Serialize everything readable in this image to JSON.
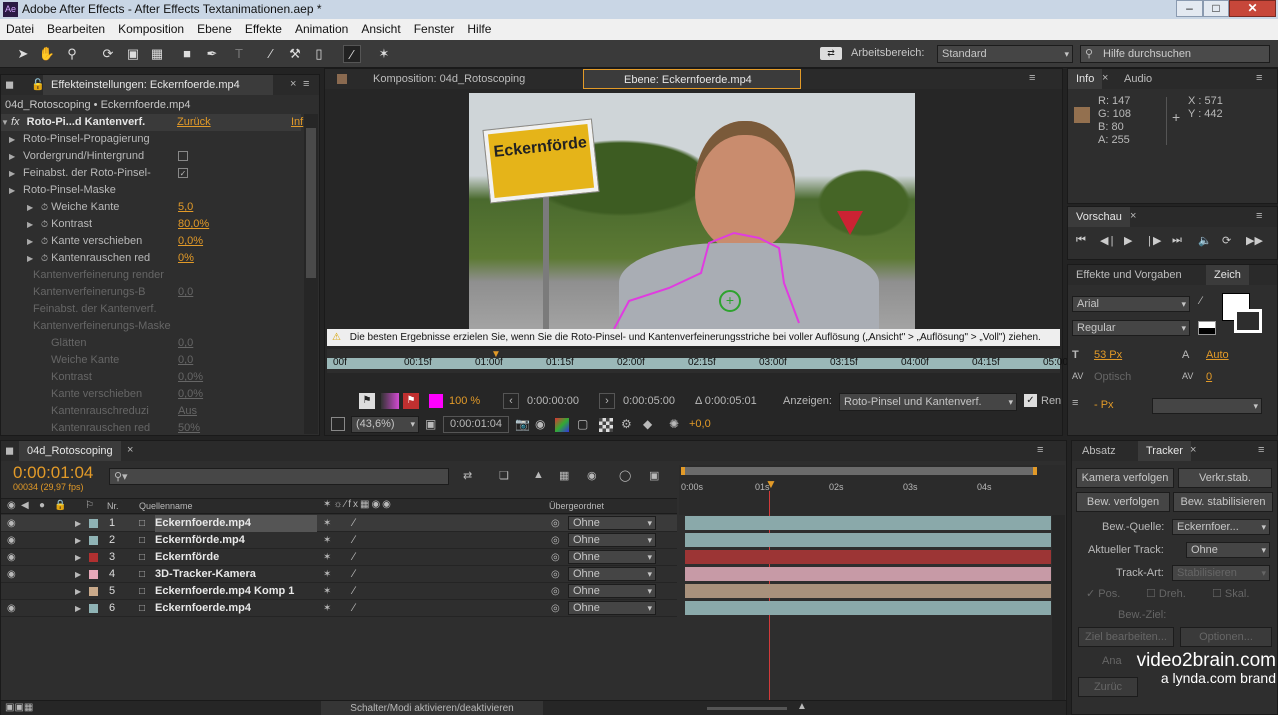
{
  "window": {
    "title": "Adobe After Effects - After Effects Textanimationen.aep *",
    "app_badge": "Ae"
  },
  "menu": [
    "Datei",
    "Bearbeiten",
    "Komposition",
    "Ebene",
    "Effekte",
    "Animation",
    "Ansicht",
    "Fenster",
    "Hilfe"
  ],
  "toolbar": {
    "workspace_label": "Arbeitsbereich:",
    "workspace_value": "Standard",
    "help_placeholder": "Hilfe durchsuchen"
  },
  "effects_panel": {
    "tab": "Effekteinstellungen: Eckernfoerde.mp4",
    "breadcrumb": "04d_Rotoscoping • Eckernfoerde.mp4",
    "effect_name": "Roto-Pi...d Kantenverf.",
    "reset": "Zurück",
    "info": "Inf",
    "rows": [
      {
        "label": "Roto-Pinsel-Propagierung",
        "value": "",
        "indent": 1
      },
      {
        "label": "Vordergrund/Hintergrund",
        "value": "",
        "indent": 1
      },
      {
        "label": "Feinabst. der Roto-Pinsel-",
        "value": "",
        "indent": 1
      },
      {
        "label": "Roto-Pinsel-Maske",
        "value": "",
        "indent": 1
      },
      {
        "label": "Weiche Kante",
        "value": "5,0",
        "indent": 2
      },
      {
        "label": "Kontrast",
        "value": "80,0%",
        "indent": 2
      },
      {
        "label": "Kante verschieben",
        "value": "0,0%",
        "indent": 2
      },
      {
        "label": "Kantenrauschen red",
        "value": "0%",
        "indent": 2
      }
    ],
    "dim_rows": [
      {
        "label": "Kantenverfeinerung render",
        "value": ""
      },
      {
        "label": "Kantenverfeinerungs-B",
        "value": "0,0"
      },
      {
        "label": "Feinabst. der Kantenverf.",
        "value": ""
      },
      {
        "label": "Kantenverfeinerungs-Maske",
        "value": ""
      },
      {
        "label": "Glätten",
        "value": "0,0"
      },
      {
        "label": "Weiche Kante",
        "value": "0,0"
      },
      {
        "label": "Kontrast",
        "value": "0,0%"
      },
      {
        "label": "Kante verschieben",
        "value": "0,0%"
      },
      {
        "label": "Kantenrauschreduzi",
        "value": "Aus"
      },
      {
        "label": "Kantenrauschen red",
        "value": "50%"
      }
    ]
  },
  "viewer": {
    "tab_comp": "Komposition: 04d_Rotoscoping",
    "tab_layer": "Ebene: Eckernfoerde.mp4",
    "sign_text": "Eckernförde",
    "warning": "Die besten Ergebnisse erzielen Sie, wenn Sie die Roto-Pinsel- und Kantenverfeinerungsstriche bei voller Auflösung („Ansicht\" > „Auflösung\" > „Voll\") ziehen.",
    "ruler": [
      "00f",
      "00:15f",
      "01:00f",
      "01:15f",
      "02:00f",
      "02:15f",
      "03:00f",
      "03:15f",
      "04:00f",
      "04:15f",
      "05:00"
    ],
    "brush_size": "100 %",
    "time_in": "0:00:00:00",
    "time_out": "0:00:05:00",
    "duration": "Δ 0:00:05:01",
    "show_label": "Anzeigen:",
    "show_value": "Roto-Pinsel und Kantenverf.",
    "render": "Ren",
    "zoom": "(43,6%)",
    "current_time": "0:00:01:04",
    "exposure": "+0,0"
  },
  "info_panel": {
    "tab": "Info",
    "tab2": "Audio",
    "r": "R:  147",
    "g": "G:  108",
    "b": "B:  80",
    "a": "A:  255",
    "x": "X : 571",
    "y": "Y : 442",
    "swatch_color": "#93704f"
  },
  "preview_panel": {
    "tab": "Vorschau"
  },
  "char_panel": {
    "tab": "Effekte und Vorgaben",
    "tab2": "Zeich",
    "font": "Arial",
    "style": "Regular",
    "size": "53 Px",
    "leading": "Auto",
    "tracking_label": "Optisch",
    "tracking": "0",
    "stroke": "- Px"
  },
  "timeline": {
    "tab": "04d_Rotoscoping",
    "time": "0:00:01:04",
    "frames": "00034 (29,97 fps)",
    "search_placeholder": "",
    "col_nr": "Nr.",
    "col_name": "Quellenname",
    "col_parent": "Übergeordnet",
    "ruler": [
      "0:00s",
      "01s",
      "02s",
      "03s",
      "04s"
    ],
    "layers": [
      {
        "nr": "1",
        "name": "Eckernfoerde.mp4",
        "parent": "Ohne",
        "color": "#8fb3b5",
        "bar": "#8aa9aa",
        "selected": true
      },
      {
        "nr": "2",
        "name": "Eckernförde.mp4",
        "parent": "Ohne",
        "color": "#8fb3b5",
        "bar": "#8aa9aa",
        "selected": false
      },
      {
        "nr": "3",
        "name": "Eckernförde",
        "parent": "Ohne",
        "color": "#b03030",
        "bar": "#9c3535",
        "selected": false
      },
      {
        "nr": "4",
        "name": "3D-Tracker-Kamera",
        "parent": "Ohne",
        "color": "#e7a9b9",
        "bar": "#c79aa6",
        "selected": false
      },
      {
        "nr": "5",
        "name": "Eckernfoerde.mp4 Komp 1",
        "parent": "Ohne",
        "color": "#c9a98a",
        "bar": "#a8917c",
        "selected": false
      },
      {
        "nr": "6",
        "name": "Eckernfoerde.mp4",
        "parent": "Ohne",
        "color": "#8fb3b5",
        "bar": "#8aa9aa",
        "selected": false
      }
    ],
    "footer": "Schalter/Modi aktivieren/deaktivieren"
  },
  "tracker_panel": {
    "tab": "Absatz",
    "tab2": "Tracker",
    "camera_track": "Kamera verfolgen",
    "warp": "Verkr.stab.",
    "track_motion": "Bew. verfolgen",
    "stabilize": "Bew. stabilisieren",
    "source_label": "Bew.-Quelle:",
    "source_value": "Eckernfoer...",
    "current_label": "Aktueller Track:",
    "current_value": "Ohne",
    "type_label": "Track-Art:",
    "type_value": "Stabilisieren",
    "pos": "Pos.",
    "rot": "Dreh.",
    "scale": "Skal.",
    "target": "Bew.-Ziel:",
    "edit_target": "Ziel bearbeiten...",
    "options": "Optionen...",
    "analyze": "Ana",
    "reset": "Zurüc"
  },
  "watermark": {
    "line1": "video2brain.com",
    "line2": "a lynda.com brand"
  }
}
